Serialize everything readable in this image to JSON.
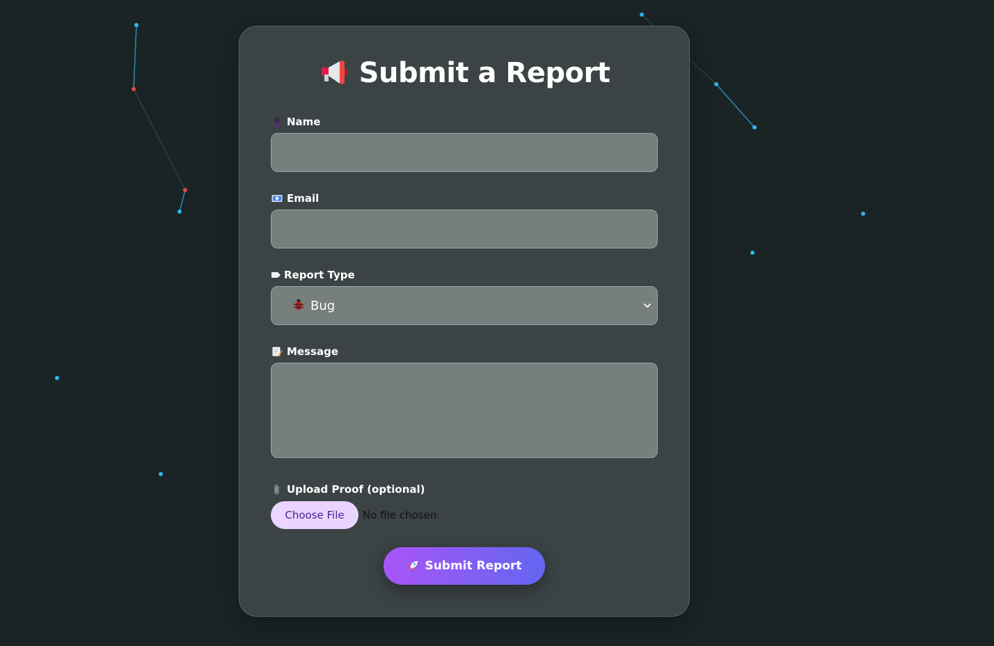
{
  "form": {
    "title": "Submit a Report",
    "title_icon": "megaphone-icon",
    "fields": {
      "name": {
        "label": "Name",
        "icon": "person-icon",
        "value": ""
      },
      "email": {
        "label": "Email",
        "icon": "envelope-icon",
        "value": ""
      },
      "report_type": {
        "label": "Report Type",
        "icon": "label-tag-icon",
        "selected": "Bug",
        "selected_icon": "ladybug-icon"
      },
      "message": {
        "label": "Message",
        "icon": "memo-icon",
        "value": ""
      },
      "upload": {
        "label": "Upload Proof (optional)",
        "icon": "paperclip-icon",
        "button_label": "Choose File",
        "status": "No file chosen"
      }
    },
    "submit": {
      "label": "Submit Report",
      "icon": "rocket-icon"
    }
  },
  "colors": {
    "background": "#1b2425",
    "card": "#3b4345",
    "field": "#767f7d",
    "accent_start": "#a855f7",
    "accent_end": "#6366f1",
    "particle_blue": "#2fb4f0",
    "particle_red": "#e5483f"
  }
}
